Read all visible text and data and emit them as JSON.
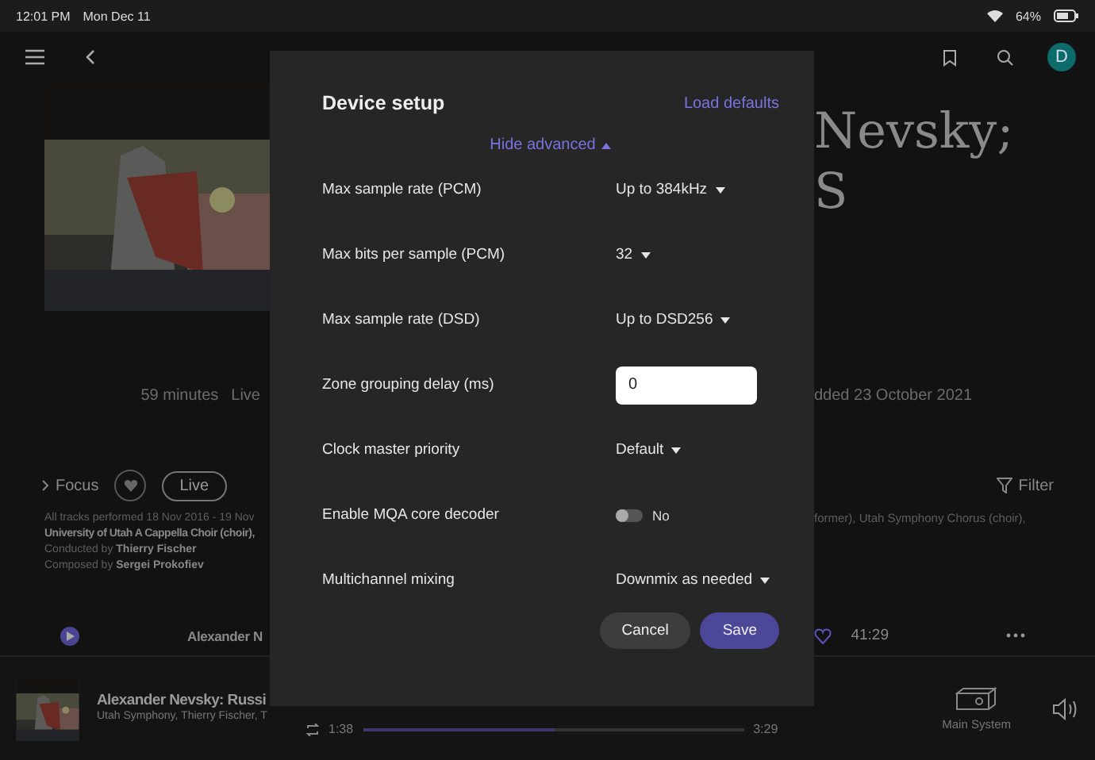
{
  "status_bar": {
    "time": "12:01 PM",
    "date": "Mon Dec 11",
    "battery": "64%"
  },
  "nav": {
    "avatar": "D"
  },
  "album": {
    "title_lines": [
      "Nevsky;",
      "S"
    ],
    "meta_left": [
      "59 minutes",
      "Live"
    ],
    "meta_right": "dded 23 October 2021"
  },
  "actions": {
    "focus": "Focus",
    "live": "Live",
    "filter": "Filter"
  },
  "credits": {
    "left": [
      {
        "kind": "plain",
        "text": "All tracks performed 18 Nov 2016 - 19 Nov"
      },
      {
        "kind": "bold",
        "text": "University of Utah A Cappella Choir (choir),"
      },
      {
        "kind": "mixed",
        "text": "Conducted by **Thierry Fischer**"
      },
      {
        "kind": "mixed",
        "text": "Composed by **Sergei Prokofiev**"
      }
    ],
    "right": "former), Utah Symphony Chorus (choir),"
  },
  "track": {
    "title": "Alexander N",
    "favorite": false,
    "duration": "41:29"
  },
  "now_playing": {
    "title": "Alexander Nevsky: Russi",
    "artists": "Utah Symphony, Thierry Fischer, T",
    "elapsed": "1:38",
    "total": "3:29",
    "level": 0.5,
    "zone": "Main System"
  },
  "modal": {
    "title": "Device setup",
    "load_defaults": "Load defaults",
    "toggle_advanced": "Hide advanced",
    "expanded": true,
    "settings": [
      {
        "label": "Max sample rate (PCM)",
        "kind": "dropdown",
        "value": "Up to 384kHz"
      },
      {
        "label": "Max bits per sample (PCM)",
        "kind": "dropdown",
        "value": "32"
      },
      {
        "label": "Max sample rate (DSD)",
        "kind": "dropdown",
        "value": "Up to DSD256"
      },
      {
        "label": "Zone grouping delay (ms)",
        "kind": "input",
        "value": "0"
      },
      {
        "label": "Clock master priority",
        "kind": "dropdown",
        "value": "Default"
      },
      {
        "label": "Enable MQA core decoder",
        "kind": "toggle",
        "on": false,
        "value": "No"
      },
      {
        "label": "Multichannel mixing",
        "kind": "dropdown",
        "value": "Downmix as needed"
      }
    ],
    "buttons": [
      {
        "label": "Cancel",
        "kind": "secondary"
      },
      {
        "label": "Save",
        "kind": "primary"
      }
    ]
  }
}
